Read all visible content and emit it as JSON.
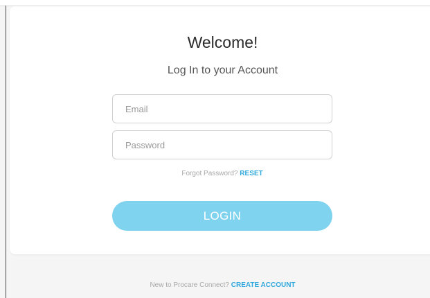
{
  "login_card": {
    "title": "Welcome!",
    "subtitle": "Log In to your Account",
    "email_placeholder": "Email",
    "password_placeholder": "Password",
    "forgot_prompt": "Forgot Password?",
    "reset_label": "RESET",
    "login_label": "LOGIN"
  },
  "footer": {
    "signup_prompt": "New to Procare Connect?",
    "create_account_label": "CREATE ACCOUNT"
  },
  "colors": {
    "accent": "#2ea8dc",
    "login_button": "#7fd3ef"
  }
}
